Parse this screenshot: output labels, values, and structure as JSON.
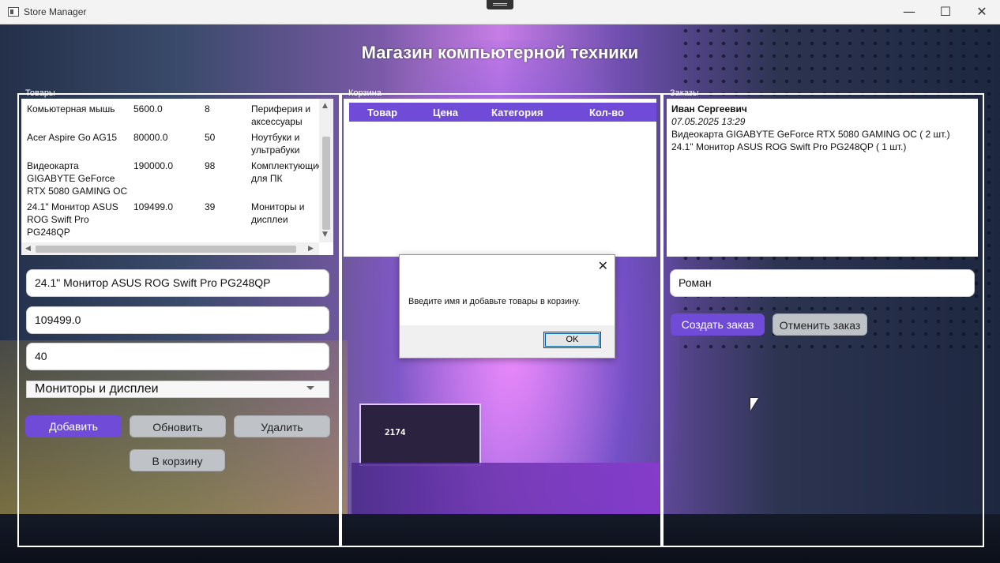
{
  "window": {
    "title": "Store Manager",
    "minimize": "—",
    "maximize": "☐",
    "close": "✕"
  },
  "heading": "Магазин компьютерной техники",
  "groups": {
    "products": "Товары",
    "cart": "Корзина",
    "orders": "Заказы"
  },
  "products": {
    "rows": [
      {
        "name": "Комьютерная мышь",
        "price": "5600.0",
        "qty": "8",
        "category": "Периферия и аксессуары"
      },
      {
        "name": "Acer Aspire Go AG15",
        "price": "80000.0",
        "qty": "50",
        "category": "Ноутбуки и ультрабуки"
      },
      {
        "name": "Видеокарта GIGABYTE GeForce RTX 5080 GAMING OC",
        "price": "190000.0",
        "qty": "98",
        "category": "Комплектующие для ПК"
      },
      {
        "name": "24.1\" Монитор ASUS ROG Swift Pro PG248QP",
        "price": "109499.0",
        "qty": "39",
        "category": "Мониторы и дисплеи"
      }
    ]
  },
  "form": {
    "name": "24.1\" Монитор ASUS ROG Swift Pro PG248QP",
    "price": "109499.0",
    "qty": "40",
    "category": "Мониторы и дисплеи"
  },
  "buttons": {
    "add": "Добавить",
    "update": "Обновить",
    "delete": "Удалить",
    "to_cart": "В корзину",
    "create_order": "Создать заказ",
    "cancel_order": "Отменить заказ"
  },
  "cart": {
    "columns": [
      "Товар",
      "Цена",
      "Категория",
      "Кол-во"
    ]
  },
  "orders": {
    "customer": "Иван Сергеевич",
    "date": "07.05.2025 13:29",
    "items": [
      "Видеокарта GIGABYTE GeForce RTX 5080 GAMING OC   ( 2  шт.)",
      "24.1\" Монитор ASUS ROG Swift Pro PG248QP  ( 1  шт.)"
    ]
  },
  "customer_name": "Роман",
  "dialog": {
    "message": "Введите имя и добавьте товары в корзину.",
    "ok": "OK",
    "close": "✕"
  },
  "background": {
    "gpu_text": "2174"
  }
}
